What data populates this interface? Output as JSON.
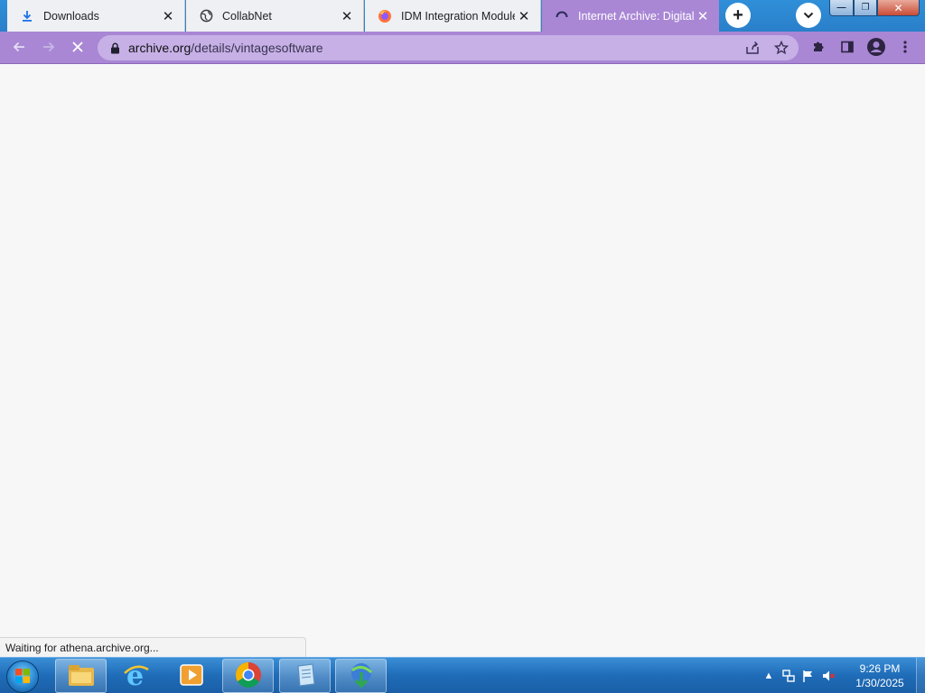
{
  "tabs": [
    {
      "title": "Downloads",
      "icon": "download-icon",
      "active": false
    },
    {
      "title": "CollabNet",
      "icon": "globe-icon",
      "active": false
    },
    {
      "title": "IDM Integration Module",
      "icon": "firefox-icon",
      "active": false
    },
    {
      "title": "Internet Archive: Digital L",
      "icon": "loading-spinner-icon",
      "active": true
    }
  ],
  "tabstrip": {
    "new_tab_label": "+",
    "tab_search_icon": "chevron-down-icon"
  },
  "window_controls": {
    "minimize": "—",
    "maximize": "❐",
    "close": "✕"
  },
  "toolbar": {
    "back_icon": "back-arrow-icon",
    "forward_icon": "forward-arrow-icon",
    "stop_icon": "stop-icon",
    "url_host": "archive.org",
    "url_path": "/details/vintagesoftware",
    "share_icon": "share-icon",
    "bookmark_icon": "star-icon",
    "extensions_icon": "puzzle-icon",
    "sidepanel_icon": "side-panel-icon",
    "profile_icon": "profile-icon",
    "menu_icon": "kebab-menu-icon"
  },
  "status": {
    "text": "Waiting for athena.archive.org..."
  },
  "taskbar": {
    "apps": [
      "file-explorer-icon",
      "internet-explorer-icon",
      "media-player-icon",
      "chrome-icon",
      "notepad-icon",
      "idm-icon"
    ],
    "clock_time": "9:26 PM",
    "clock_date": "1/30/2025"
  },
  "colors": {
    "theme": "#a987d5",
    "omnibox": "#c6b0e6",
    "tabstrip": "#2a7fc9",
    "taskbar": "#1f6cb8"
  }
}
